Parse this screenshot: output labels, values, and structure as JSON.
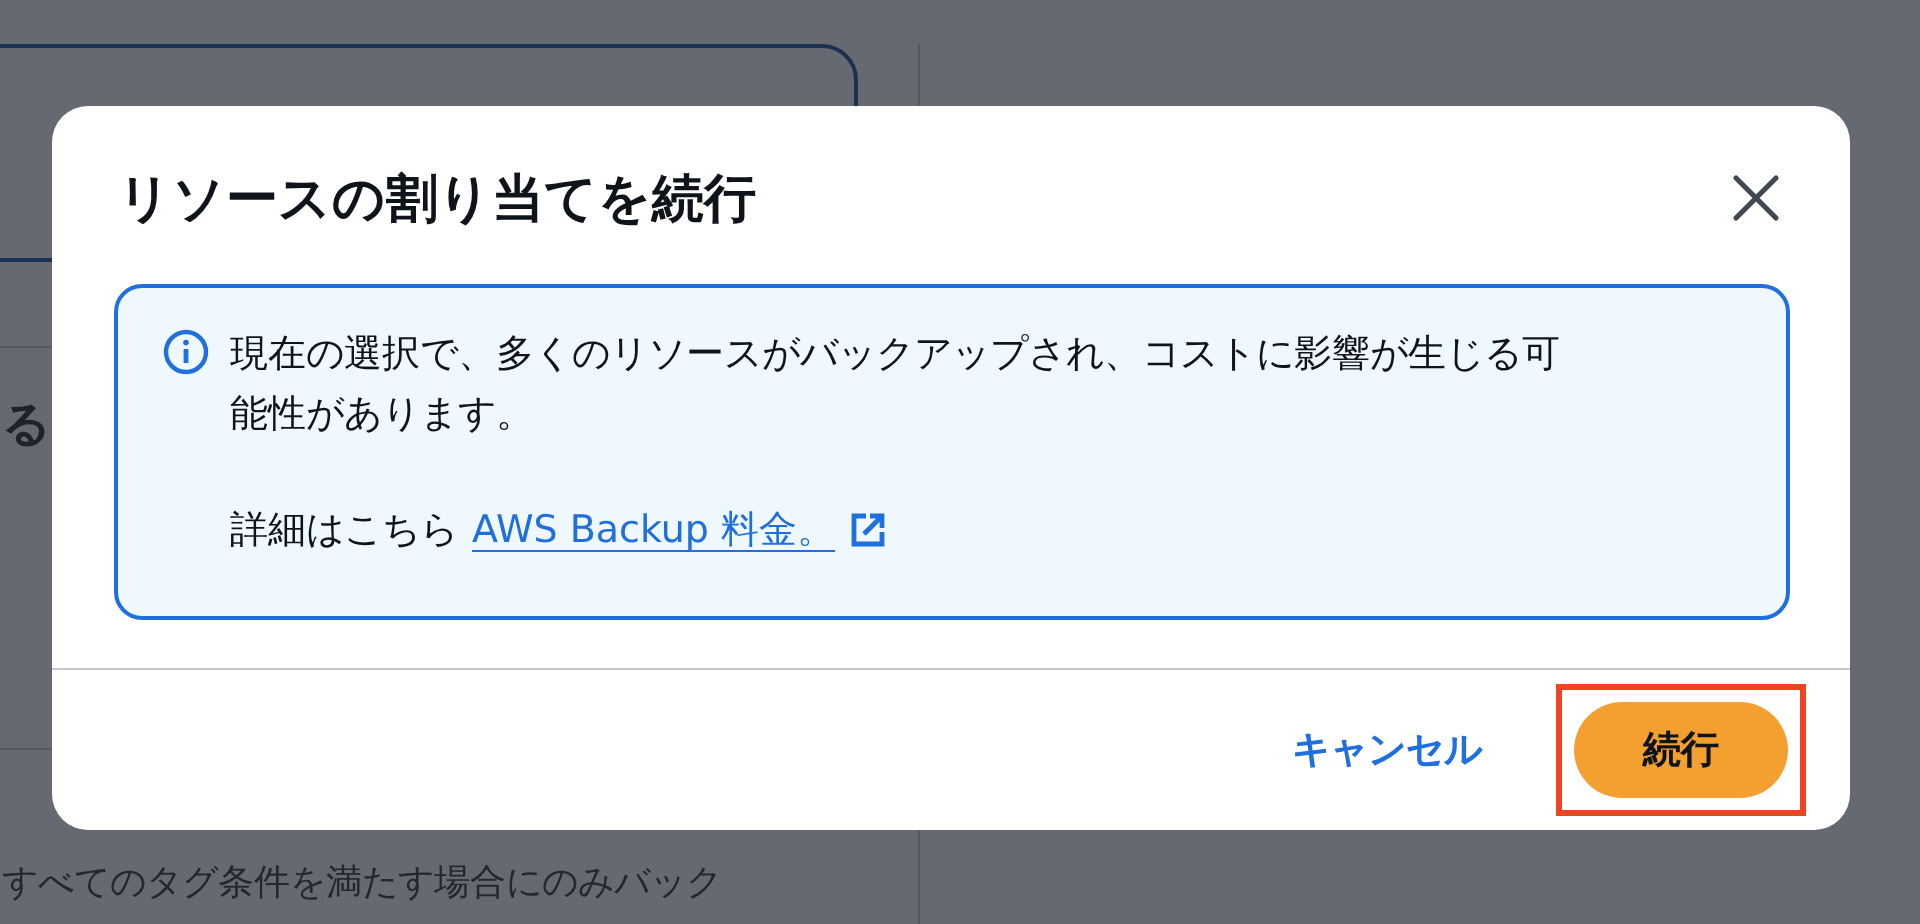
{
  "background": {
    "heading_fragment": "る",
    "condition_text": "すべてのタグ条件を満たす場合にのみバック"
  },
  "dialog": {
    "title": "リソースの割り当てを続行",
    "alert": {
      "message": "現在の選択で、多くのリソースがバックアップされ、コストに影響が生じる可能性があります。",
      "details_label": "詳細はこちら",
      "link": "AWS Backup 料金。"
    },
    "buttons": [
      {
        "label": "キャンセル",
        "kind": "link",
        "highlighted": false
      },
      {
        "label": "続行",
        "kind": "primary",
        "highlighted": true
      }
    ]
  }
}
